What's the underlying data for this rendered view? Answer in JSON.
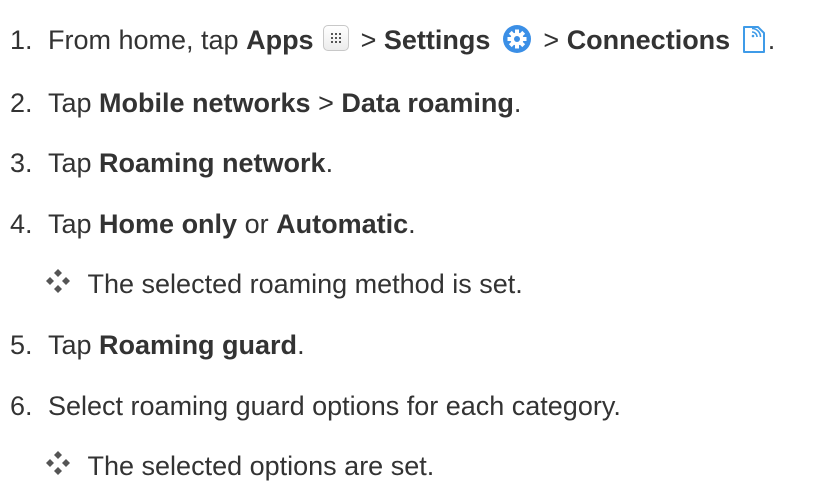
{
  "steps": [
    {
      "number": "1.",
      "parts": {
        "a": "From home, tap ",
        "apps": "Apps",
        "sep1": " > ",
        "settings": "Settings",
        "sep2": " > ",
        "connections": "Connections",
        "end": "."
      }
    },
    {
      "number": "2.",
      "parts": {
        "a": "Tap ",
        "b": "Mobile networks",
        "c": " > ",
        "d": "Data roaming",
        "e": "."
      }
    },
    {
      "number": "3.",
      "parts": {
        "a": "Tap ",
        "b": "Roaming network",
        "c": "."
      }
    },
    {
      "number": "4.",
      "parts": {
        "a": "Tap ",
        "b": "Home only",
        "c": " or ",
        "d": "Automatic",
        "e": "."
      }
    },
    {
      "number": "5.",
      "parts": {
        "a": "Tap ",
        "b": "Roaming guard",
        "c": "."
      }
    },
    {
      "number": "6.",
      "parts": {
        "a": "Select roaming guard options for each category."
      }
    }
  ],
  "results": [
    {
      "text": "The selected roaming method is set."
    },
    {
      "text": "The selected options are set."
    }
  ],
  "icons": {
    "apps": "apps-grid-icon",
    "settings": "settings-gear-icon",
    "connections": "connections-icon",
    "result": "four-diamond-bullet-icon"
  },
  "colors": {
    "text": "#333333",
    "settings_blue": "#3b8fe6",
    "connections_blue": "#3f9be8",
    "bullet_gray": "#555555"
  }
}
